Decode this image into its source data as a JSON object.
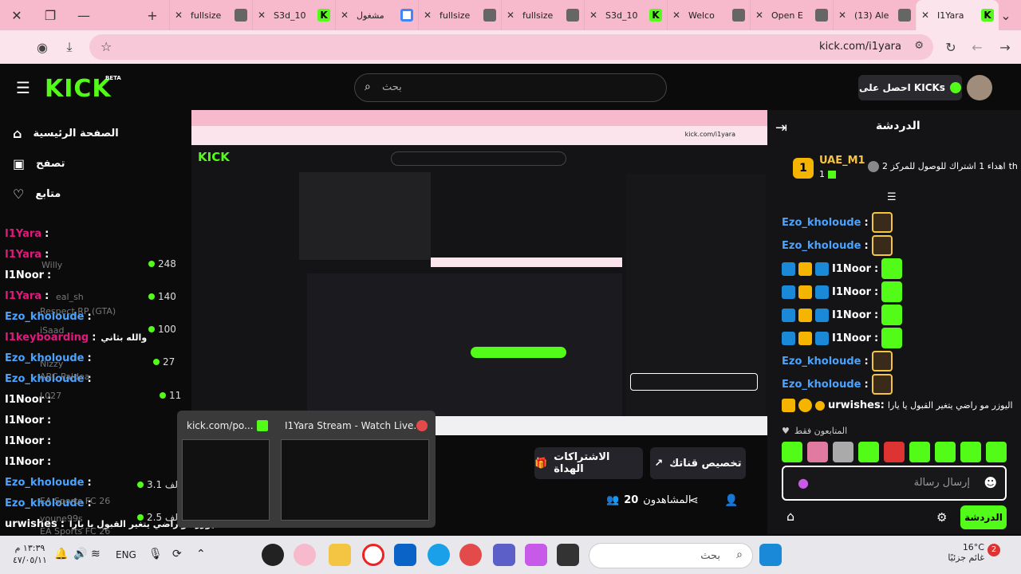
{
  "browser": {
    "tabs": [
      {
        "label": "fullsize",
        "favicon": "gray-circle"
      },
      {
        "label": "S3d_10",
        "favicon": "kick"
      },
      {
        "label": "مشغول",
        "favicon": "google"
      },
      {
        "label": "fullsize",
        "favicon": "gray-circle"
      },
      {
        "label": "fullsize",
        "favicon": "gray-circle"
      },
      {
        "label": "S3d_10",
        "favicon": "kick"
      },
      {
        "label": "Welco",
        "favicon": "gray-circle"
      },
      {
        "label": "Open E",
        "favicon": "gray-circle"
      },
      {
        "label": "(13) Ale",
        "favicon": "gray-circle"
      },
      {
        "label": "I1Yara",
        "favicon": "kick",
        "active": true
      }
    ],
    "url": "kick.com/i1yara"
  },
  "header": {
    "logo": "KICK",
    "logo_badge": "BETA",
    "search_placeholder": "بحث",
    "get_kicks": "احصل على KICKs"
  },
  "sidebar": {
    "items": [
      {
        "label": "الصفحة الرئيسية",
        "icon": "home-icon"
      },
      {
        "label": "تصفح",
        "icon": "browse-icon"
      },
      {
        "label": "متابع",
        "icon": "heart-icon"
      }
    ]
  },
  "left_chat": [
    {
      "name": "I1Yara",
      "sep": ":",
      "color": "#e0197d"
    },
    {
      "name": "I1Yara",
      "sep": ":",
      "color": "#e0197d"
    },
    {
      "name": "I1Noor",
      "sep": ":",
      "color": "#ffffff"
    },
    {
      "name": "I1Yara",
      "sep": ":",
      "color": "#e0197d"
    },
    {
      "name": "Ezo_kholoude",
      "sep": ":",
      "color": "#4aa3ff"
    },
    {
      "name": "I1keyboarding",
      "sep": ":",
      "color": "#e0197d",
      "text": "والله بثاني"
    },
    {
      "name": "Ezo_kholoude",
      "sep": ":",
      "color": "#4aa3ff"
    },
    {
      "name": "Ezo_kholoude",
      "sep": ":",
      "color": "#4aa3ff"
    },
    {
      "name": "I1Noor",
      "sep": ":",
      "color": "#ffffff"
    },
    {
      "name": "I1Noor",
      "sep": ":",
      "color": "#ffffff"
    },
    {
      "name": "I1Noor",
      "sep": ":",
      "color": "#ffffff"
    },
    {
      "name": "I1Noor",
      "sep": ":",
      "color": "#ffffff"
    },
    {
      "name": "Ezo_kholoude",
      "sep": ":",
      "color": "#4aa3ff"
    },
    {
      "name": "Ezo_kholoude",
      "sep": ":",
      "color": "#4aa3ff"
    },
    {
      "name": "urwishes",
      "sep": ":",
      "color": "#ffffff",
      "text": "اليوزر مو راضي يتغير القبول يا يارا"
    }
  ],
  "left_ghost": {
    "willy": "Willy",
    "realpsh": "eal_sh",
    "respect": "Respect RP (GTA)",
    "isaad": "iSaad",
    "nizzy": "Nizzy",
    "abc": "ABC Paldea",
    "l027": "L027",
    "eafc": "EA Sports FC 26",
    "youne": "youne99s",
    "eafc2": "EA Sports FC 26"
  },
  "left_viewers": [
    "248",
    "140",
    "100",
    "27",
    "11",
    "3.1 الف",
    "2.5 الف"
  ],
  "stream": {
    "followers_label": "المشاهدون",
    "followers": "20",
    "customize_btn": "تخصيص قناتك",
    "gifts_btn": "الاشتراكات الهداة"
  },
  "preview": {
    "tab1": "kick.com/po...",
    "tab2": "I1Yara Stream - Watch Live..."
  },
  "chat": {
    "title": "الدردشة",
    "top_gifter": {
      "name": "UAE_M1",
      "count": "1",
      "rank": "1",
      "text": "اهداء 1 اشتراك للوصول للمركز 2"
    },
    "th_label": "th",
    "messages": [
      {
        "name": "Ezo_kholoude",
        "color": "#4aa3ff",
        "badges": []
      },
      {
        "name": "Ezo_kholoude",
        "color": "#4aa3ff",
        "badges": []
      },
      {
        "name": "I1Noor",
        "color": "#ffffff",
        "badges": [
          "blue",
          "gold",
          "blue"
        ]
      },
      {
        "name": "I1Noor",
        "color": "#ffffff",
        "badges": [
          "blue",
          "gold",
          "blue"
        ]
      },
      {
        "name": "I1Noor",
        "color": "#ffffff",
        "badges": [
          "blue",
          "gold",
          "blue"
        ]
      },
      {
        "name": "I1Noor",
        "color": "#ffffff",
        "badges": [
          "blue",
          "gold",
          "blue"
        ]
      },
      {
        "name": "Ezo_kholoude",
        "color": "#4aa3ff",
        "badges": []
      },
      {
        "name": "Ezo_kholoude",
        "color": "#4aa3ff",
        "badges": []
      }
    ],
    "urwishes": {
      "name": "urwishes:",
      "text": "اليوزر مو راضي يتغير القبول يا يارا"
    },
    "followers_only": "المتابعون فقط",
    "input_placeholder": "إرسال رسالة",
    "send_button": "الدردشة"
  },
  "taskbar": {
    "search_placeholder": "بحث",
    "language": "ENG",
    "time": "١٣:٣٩ م",
    "date": "٤٧/٠٥/١١",
    "temperature": "16°C",
    "weather": "غائم جزئيًا",
    "notification_count": "2"
  },
  "colors": {
    "brand": "#53fc18",
    "tabbar": "#f7b9cc",
    "background": "#0b0b0c"
  }
}
